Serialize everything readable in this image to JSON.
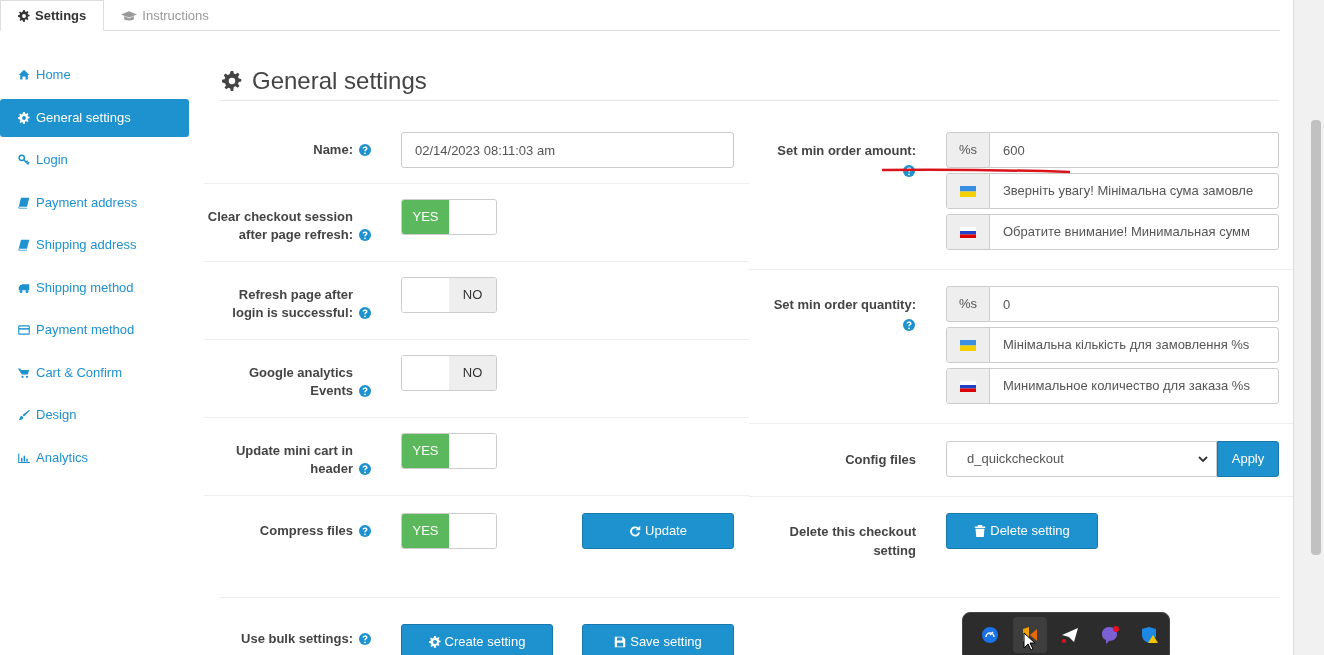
{
  "tabs": [
    {
      "label": "Settings",
      "selected": true
    },
    {
      "label": "Instructions",
      "selected": false
    }
  ],
  "sidebar": {
    "items": [
      {
        "label": "Home",
        "selected": false
      },
      {
        "label": "General settings",
        "selected": true
      },
      {
        "label": "Login",
        "selected": false
      },
      {
        "label": "Payment address",
        "selected": false
      },
      {
        "label": "Shipping address",
        "selected": false
      },
      {
        "label": "Shipping method",
        "selected": false
      },
      {
        "label": "Payment method",
        "selected": false
      },
      {
        "label": "Cart & Confirm",
        "selected": false
      },
      {
        "label": "Design",
        "selected": false
      },
      {
        "label": "Analytics",
        "selected": false
      }
    ]
  },
  "heading": "General settings",
  "left_settings": [
    {
      "kind": "text",
      "label": "Name:",
      "value": "02/14/2023 08:11:03 am"
    },
    {
      "kind": "toggle",
      "label": "Clear checkout session after page refresh:",
      "on": true,
      "text": "YES"
    },
    {
      "kind": "toggle",
      "label": "Refresh page after login is successful:",
      "on": false,
      "text": "NO"
    },
    {
      "kind": "toggle",
      "label": "Google analytics Events",
      "on": false,
      "text": "NO"
    },
    {
      "kind": "toggle",
      "label": "Update mini cart in header",
      "on": true,
      "text": "YES"
    },
    {
      "kind": "toggle",
      "label": "Compress files",
      "on": true,
      "text": "YES",
      "button": "Update"
    }
  ],
  "bulk": {
    "label": "Use bulk settings:",
    "buttons": [
      "Create setting",
      "Save setting"
    ]
  },
  "right_settings": [
    {
      "kind": "group",
      "label": "Set min order amount:",
      "prefix": "%s",
      "value": "600",
      "translations": [
        "Зверніть увагу! Мінімальна сума замовле",
        "Обратите внимание! Минимальная сумм"
      ]
    },
    {
      "kind": "group",
      "label": "Set min order quantity:",
      "prefix": "%s",
      "value": "0",
      "translations": [
        "Мінімальна кількість для замовлення %s",
        "Минимальное количество для заказа %s"
      ]
    },
    {
      "kind": "select",
      "label": "Config files",
      "value": "d_quickcheckout",
      "button": "Apply"
    },
    {
      "kind": "delete",
      "label": "Delete this checkout setting",
      "button": "Delete setting"
    }
  ]
}
